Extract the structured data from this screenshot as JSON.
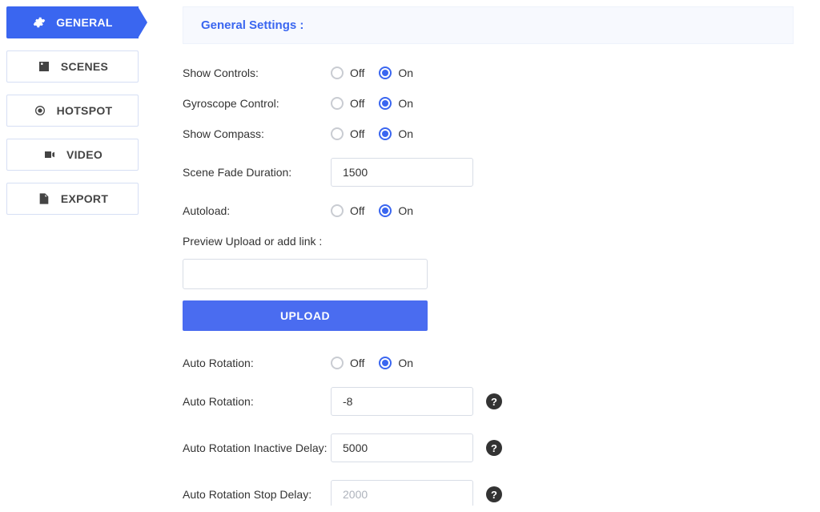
{
  "sidebar": {
    "items": [
      {
        "label": "GENERAL",
        "icon": "cogs-icon",
        "active": true
      },
      {
        "label": "SCENES",
        "icon": "image-icon",
        "active": false
      },
      {
        "label": "HOTSPOT",
        "icon": "target-icon",
        "active": false
      },
      {
        "label": "VIDEO",
        "icon": "video-icon",
        "active": false
      },
      {
        "label": "EXPORT",
        "icon": "export-icon",
        "active": false
      }
    ]
  },
  "panel": {
    "title": "General Settings :"
  },
  "radio_options": {
    "off": "Off",
    "on": "On"
  },
  "fields": {
    "show_controls": {
      "label": "Show Controls:",
      "value": "On"
    },
    "gyroscope": {
      "label": "Gyroscope Control:",
      "value": "On"
    },
    "show_compass": {
      "label": "Show Compass:",
      "value": "On"
    },
    "scene_fade": {
      "label": "Scene Fade Duration:",
      "value": "1500"
    },
    "autoload": {
      "label": "Autoload:",
      "value": "On"
    },
    "preview_upload": {
      "label": "Preview Upload or add link :",
      "value": ""
    },
    "upload_button": "UPLOAD",
    "auto_rotation_toggle": {
      "label": "Auto Rotation:",
      "value": "On"
    },
    "auto_rotation_value": {
      "label": "Auto Rotation:",
      "value": "-8"
    },
    "auto_rotation_inactive_delay": {
      "label": "Auto Rotation Inactive Delay:",
      "value": "5000"
    },
    "auto_rotation_stop_delay": {
      "label": "Auto Rotation Stop Delay:",
      "placeholder": "2000",
      "value": ""
    }
  }
}
